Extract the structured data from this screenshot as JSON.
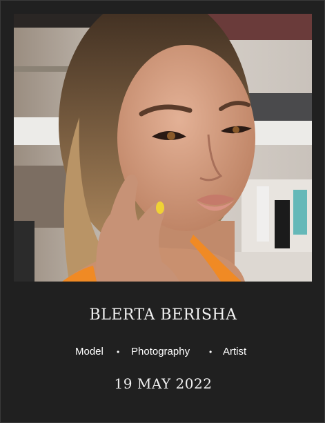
{
  "profile": {
    "name": "BLERTA BERISHA",
    "tags": [
      "Model",
      "Photography",
      "Artist"
    ],
    "separator": "•",
    "date": "19 MAY 2022"
  },
  "photo": {
    "subject": "portrait-photo",
    "accent_color": "#f08a24"
  }
}
